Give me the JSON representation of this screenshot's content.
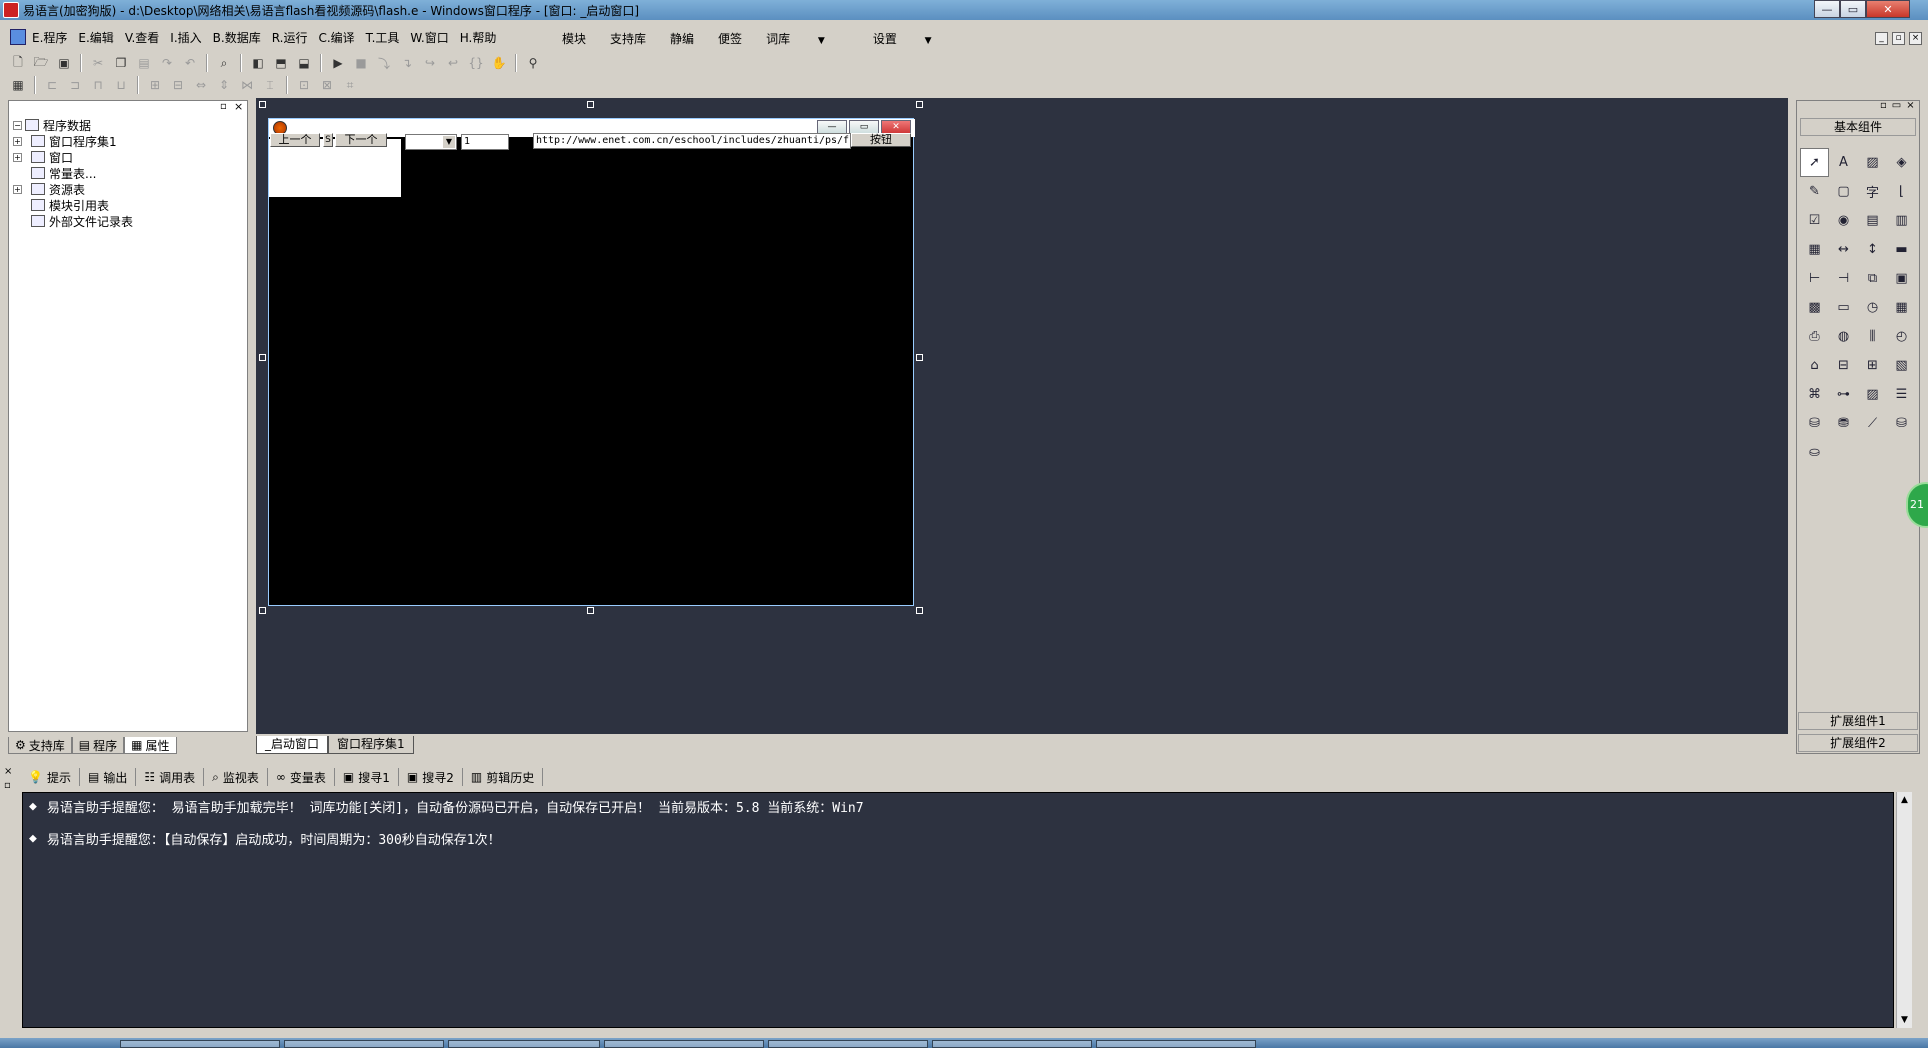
{
  "window": {
    "title": "易语言(加密狗版) - d:\\Desktop\\网络相关\\易语言flash看视频源码\\flash.e - Windows窗口程序 - [窗口: _启动窗口]",
    "min_label": "—",
    "max_label": "▭",
    "close_label": "✕"
  },
  "menubar": {
    "items": [
      "E.程序",
      "E.编辑",
      "V.查看",
      "I.插入",
      "B.数据库",
      "R.运行",
      "C.编译",
      "T.工具",
      "W.窗口",
      "H.帮助"
    ],
    "right_items": [
      "模块",
      "支持库",
      "静编",
      "便签",
      "词库",
      "设置"
    ],
    "dropdown_glyph": "▼"
  },
  "left_panel": {
    "tree": {
      "root": "程序数据",
      "items": [
        "窗口程序集1",
        "窗口",
        "常量表...",
        "资源表",
        "模块引用表",
        "外部文件记录表"
      ]
    },
    "tabs": [
      "支持库",
      "程序",
      "属性"
    ]
  },
  "design_window": {
    "buttons": [
      "上一个",
      "下一个",
      "按钮"
    ],
    "edit_value": "1",
    "url_value": "http://www.enet.com.cn/eschool/includes/zhuanti/ps/fl",
    "extra_label": "S"
  },
  "right_panel": {
    "title": "基本组件",
    "ext1": "扩展组件1",
    "ext2": "扩展组件2",
    "component_icons": [
      "pointer-icon",
      "label-icon",
      "picture-icon",
      "shape-icon",
      "edit-icon",
      "panel-icon",
      "font-icon",
      "line-icon",
      "checkbox-icon",
      "radio-icon",
      "listbox-icon",
      "frame-icon",
      "grid-icon",
      "scroll-h-icon",
      "scroll-v-icon",
      "progress-icon",
      "slider-h-icon",
      "slider-v-icon",
      "tab-icon",
      "dialog-icon",
      "table-icon",
      "button-icon",
      "timer-icon",
      "calendar-icon",
      "printer-icon",
      "globe-icon",
      "split-icon",
      "clock-icon",
      "tray-icon",
      "server-icon",
      "client-icon",
      "report-icon",
      "network-icon",
      "tree-icon",
      "image-icon",
      "list-icon",
      "database-icon",
      "db-source-icon",
      "chart-icon",
      "odbc-icon",
      "odbc-db-icon"
    ]
  },
  "document_tabs": [
    "_启动窗口",
    "窗口程序集1"
  ],
  "bottom_tabs": [
    "提示",
    "输出",
    "调用表",
    "监视表",
    "变量表",
    "搜寻1",
    "搜寻2",
    "剪辑历史"
  ],
  "output": {
    "lines": [
      "易语言助手提醒您： 易语言助手加载完毕！ 词库功能[关闭]，自动备份源码已开启，自动保存已开启！ 当前易版本：5.8  当前系统：Win7",
      "易语言助手提醒您：【自动保存】启动成功，时间周期为：300秒自动保存1次！"
    ]
  },
  "side_badge": "21"
}
